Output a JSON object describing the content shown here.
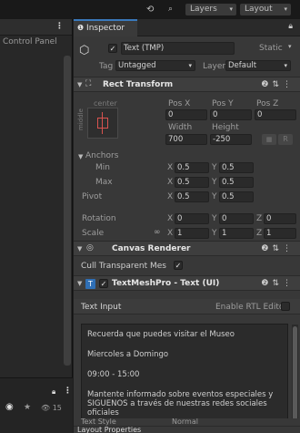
{
  "toolbar": {
    "layers_label": "Layers",
    "layout_label": "Layout"
  },
  "left_panel": {
    "title": "Control Panel",
    "count": "15"
  },
  "inspector": {
    "tab_label": "Inspector",
    "object": {
      "name": "Text (TMP)",
      "static_label": "Static",
      "tag_label": "Tag",
      "tag_value": "Untagged",
      "layer_label": "Layer",
      "layer_value": "Default"
    },
    "rect_transform": {
      "title": "Rect Transform",
      "anchor_h": "center",
      "anchor_v": "middle",
      "pos_x_label": "Pos X",
      "pos_y_label": "Pos Y",
      "pos_z_label": "Pos Z",
      "pos_x": "0",
      "pos_y": "0",
      "pos_z": "0",
      "width_label": "Width",
      "height_label": "Height",
      "width": "700",
      "height": "-250",
      "r_label": "R",
      "anchors_label": "Anchors",
      "min_label": "Min",
      "max_label": "Max",
      "min_x": "0.5",
      "min_y": "0.5",
      "max_x": "0.5",
      "max_y": "0.5",
      "pivot_label": "Pivot",
      "pivot_x": "0.5",
      "pivot_y": "0.5",
      "rotation_label": "Rotation",
      "rot_x": "0",
      "rot_y": "0",
      "rot_z": "0",
      "scale_label": "Scale",
      "scale_x": "1",
      "scale_y": "1",
      "scale_z": "1",
      "x_label": "X",
      "y_label": "Y",
      "z_label": "Z"
    },
    "canvas_renderer": {
      "title": "Canvas Renderer",
      "cull_label": "Cull Transparent Mes"
    },
    "textmeshpro": {
      "title": "TextMeshPro - Text (UI)",
      "text_input_label": "Text Input",
      "rtl_label": "Enable RTL Editor",
      "lines": [
        "Recuerda que puedes visitar el Museo",
        "Miercoles a Domingo",
        "09:00 - 15:00",
        "Mantente informado sobre eventos especiales y",
        "SIGUENOS a través de nuestras redes sociales",
        "oficiales"
      ],
      "text_style_label": "Text Style",
      "text_style_value": "Normal"
    },
    "layout_properties_label": "Layout Properties"
  }
}
